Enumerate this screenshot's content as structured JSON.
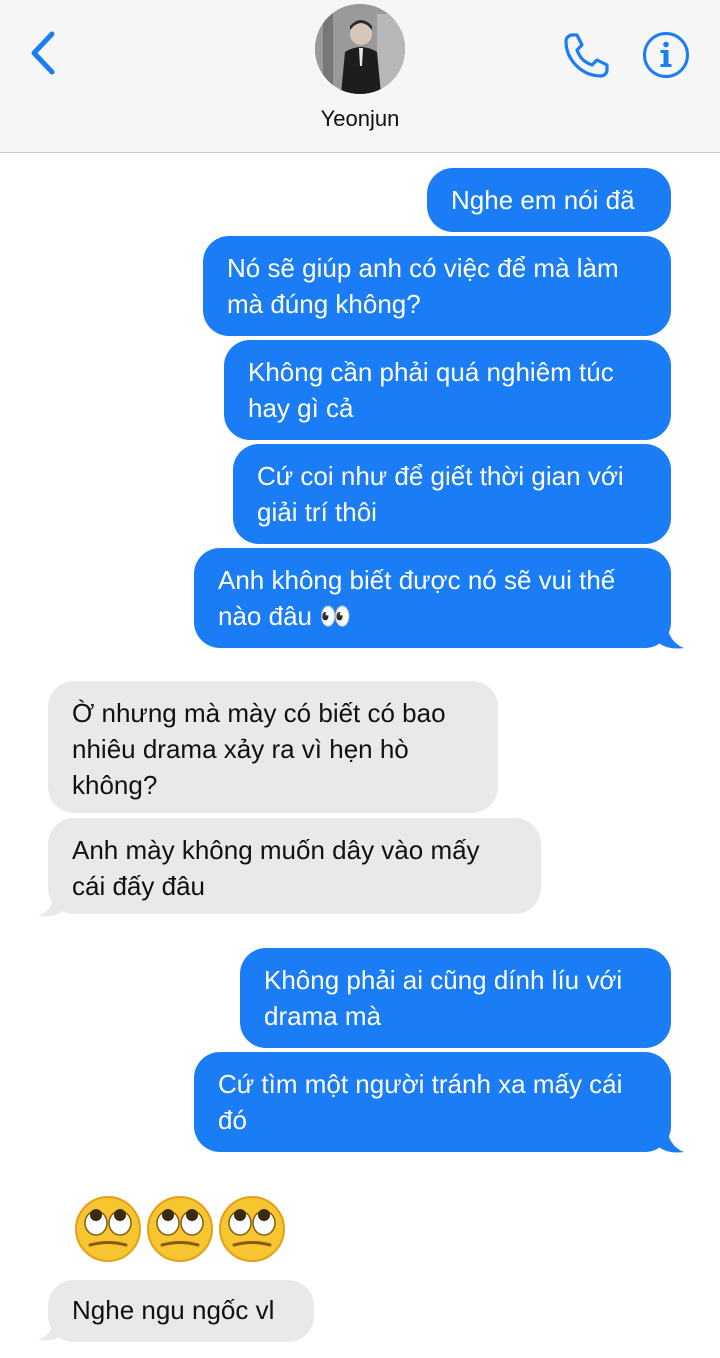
{
  "contact": {
    "name": "Yeonjun"
  },
  "colors": {
    "accent": "#1a7df6",
    "sent_bubble": "#1a7df6",
    "received_bubble": "#e9e9eb"
  },
  "icons": {
    "back": "chevron-left-icon",
    "call": "phone-icon",
    "info": "info-icon",
    "reaction": "face-with-rolling-eyes-emoji"
  },
  "messages": [
    {
      "from": "me",
      "text": "Nghe em nói đã"
    },
    {
      "from": "me",
      "text": "Nó sẽ giúp anh có việc để mà làm mà đúng không?"
    },
    {
      "from": "me",
      "text": "Không cần phải quá nghiêm túc hay gì cả"
    },
    {
      "from": "me",
      "text": "Cứ coi như để giết thời gian với giải trí thôi"
    },
    {
      "from": "me",
      "text": "Anh không biết được nó sẽ vui thế nào đâu 👀"
    },
    {
      "from": "them",
      "text": "Ờ nhưng mà mày có biết có bao nhiêu drama xảy ra vì hẹn hò không?"
    },
    {
      "from": "them",
      "text": "Anh mày không muốn dây vào mấy cái đấy đâu"
    },
    {
      "from": "me",
      "text": "Không phải ai cũng dính líu với drama mà"
    },
    {
      "from": "me",
      "text": "Cứ tìm một người tránh xa mấy cái đó"
    },
    {
      "from": "them",
      "emoji_count": 3
    },
    {
      "from": "them",
      "text": "Nghe ngu ngốc vl"
    }
  ]
}
